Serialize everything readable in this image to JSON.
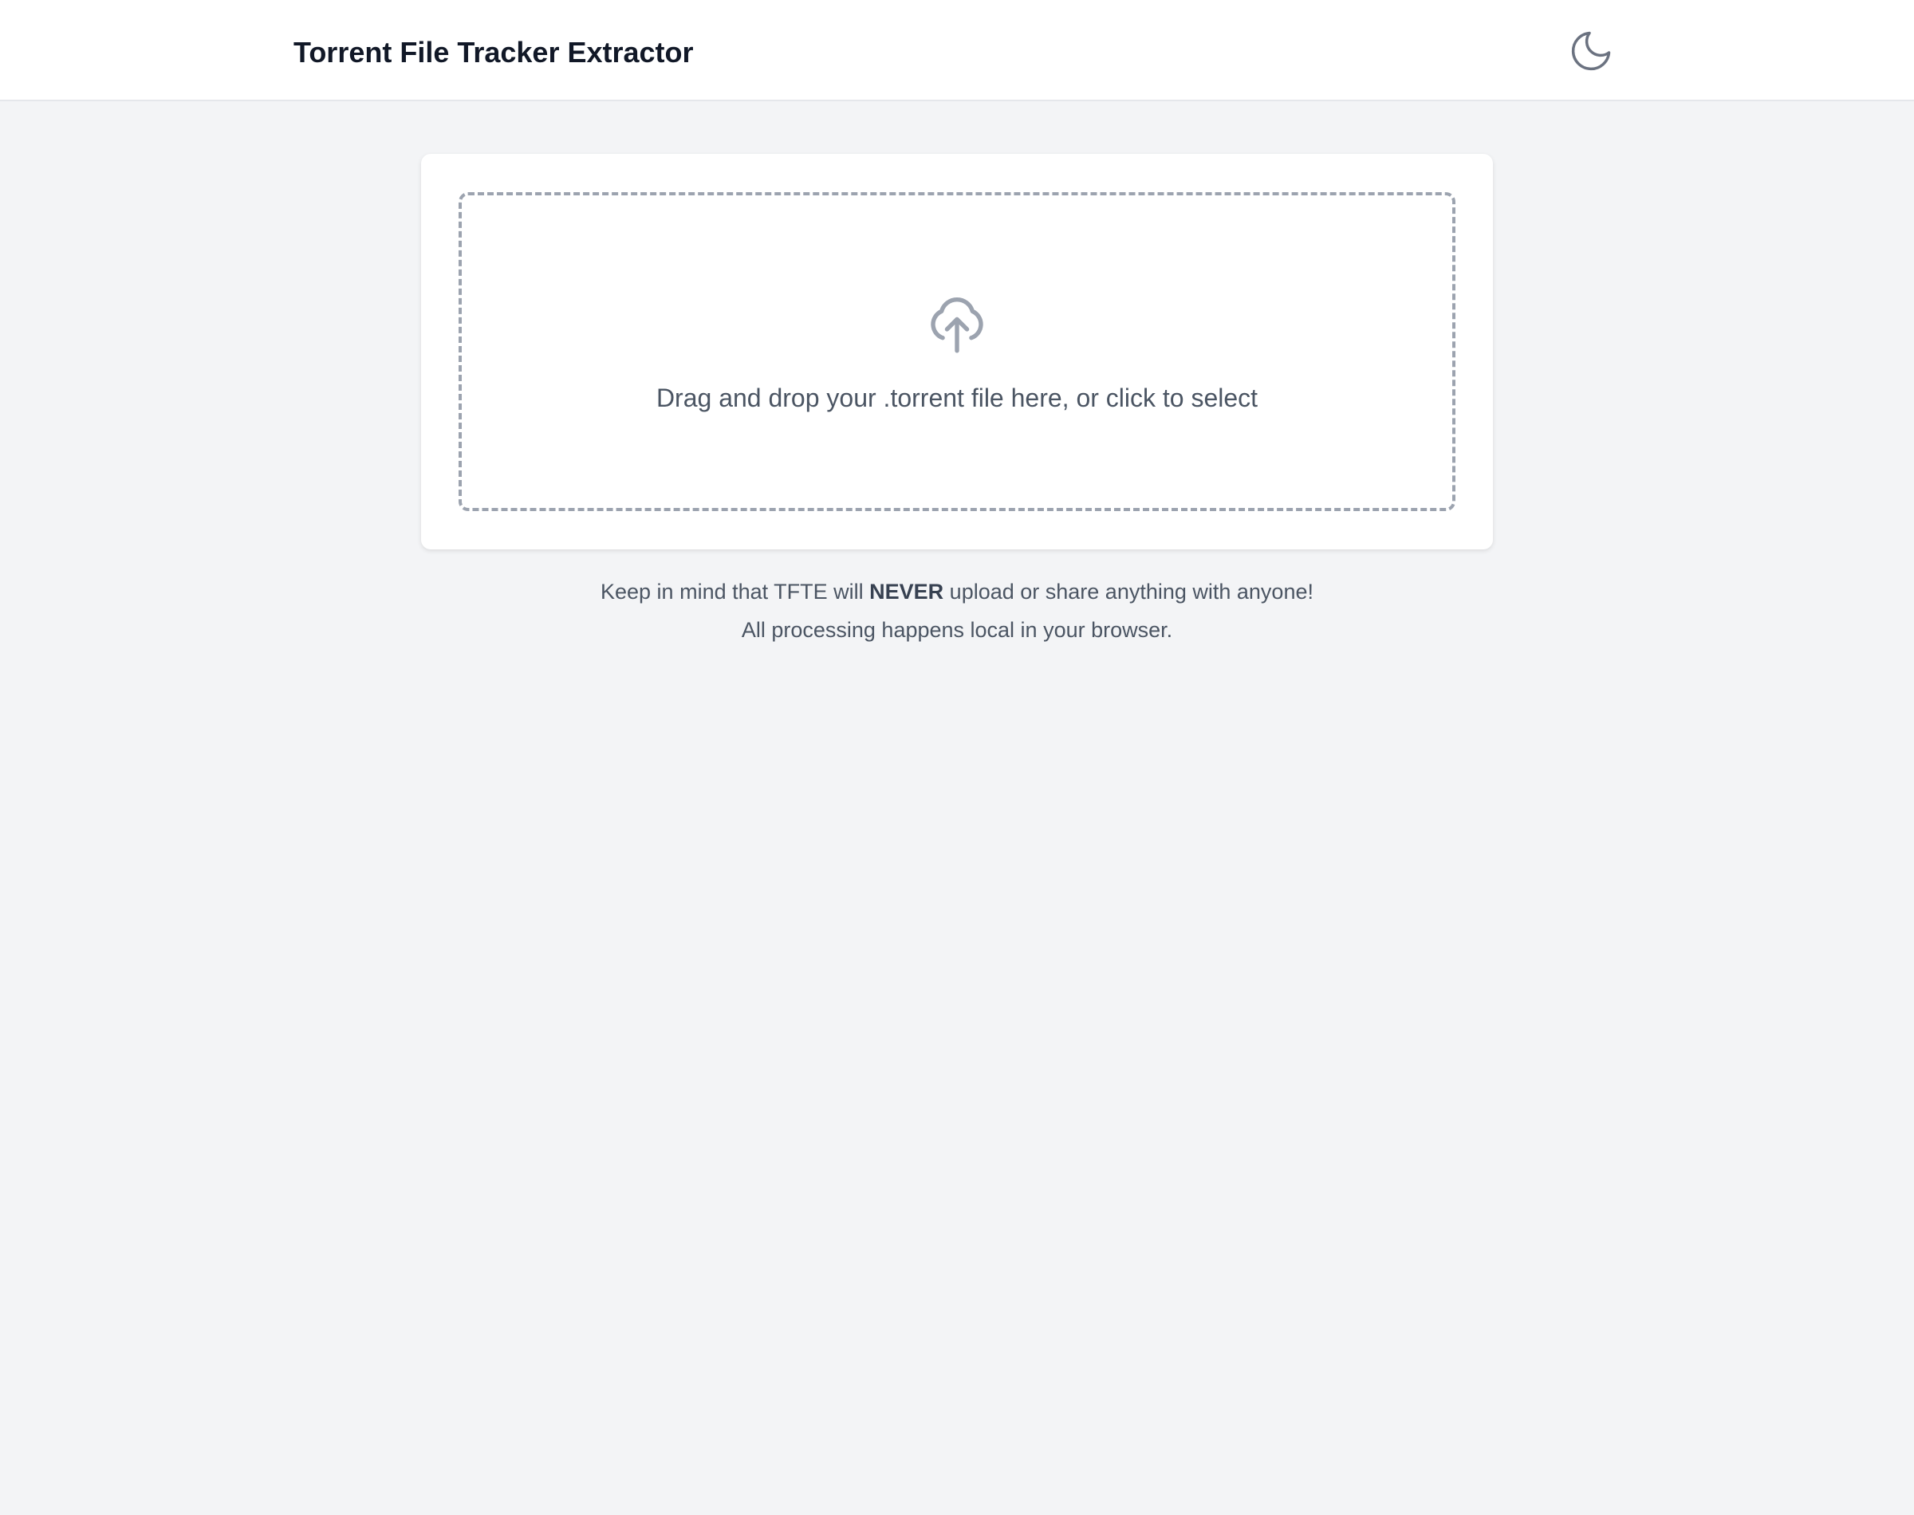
{
  "header": {
    "title": "Torrent File Tracker Extractor",
    "theme_toggle_icon": "moon-icon"
  },
  "dropzone": {
    "icon": "cloud-upload-icon",
    "text": "Drag and drop your .torrent file here, or click to select"
  },
  "notice": {
    "line1_prefix": "Keep in mind that TFTE will ",
    "line1_emphasis": "NEVER",
    "line1_suffix": " upload or share anything with anyone!",
    "line2": "All processing happens local in your browser."
  },
  "colors": {
    "page_background": "#f3f4f6",
    "surface": "#ffffff",
    "title_text": "#111827",
    "body_text": "#4b5563",
    "dashed_border": "#9ca3af",
    "icon": "#6b7280"
  }
}
